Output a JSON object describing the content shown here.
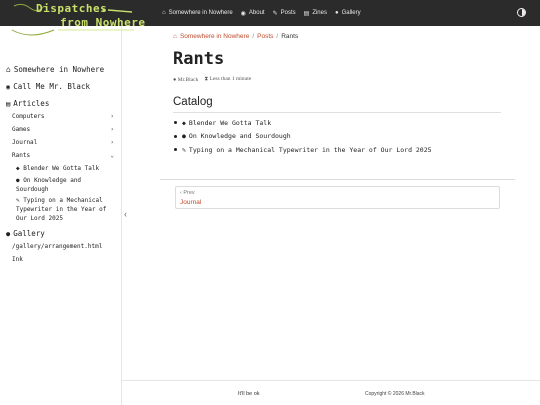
{
  "site": {
    "logo_line1": "Dispatches",
    "logo_line2": "from Nowhere"
  },
  "nav": {
    "items": [
      {
        "label": "Somewhere in Nowhere",
        "icon": "home-icon"
      },
      {
        "label": "About",
        "icon": "eye-icon"
      },
      {
        "label": "Posts",
        "icon": "edit-icon"
      },
      {
        "label": "Zines",
        "icon": "book-icon"
      },
      {
        "label": "Gallery",
        "icon": "palette-icon"
      }
    ],
    "theme_icon": "contrast-icon"
  },
  "sidebar": {
    "home": "Somewhere in Nowhere",
    "call": "Call Me Mr. Black",
    "articles": "Articles",
    "categories": [
      {
        "label": "Computers",
        "chevron": "›"
      },
      {
        "label": "Games",
        "chevron": "›"
      },
      {
        "label": "Journal",
        "chevron": "›"
      },
      {
        "label": "Rants",
        "chevron": "⌄"
      }
    ],
    "rants": [
      {
        "label": "Blender We Gotta Talk",
        "icon": "cube-icon"
      },
      {
        "label": "On Knowledge and Sourdough",
        "icon": "person-icon"
      },
      {
        "label": "Typing on a Mechanical Typewriter in the Year of Our Lord 2025",
        "icon": "pencil-icon"
      }
    ],
    "gallery": "Gallery",
    "gallery_links": [
      "/gallery/arrangement.html",
      "Ink"
    ],
    "collapse": "‹"
  },
  "breadcrumb": {
    "home": "Somewhere in Nowhere",
    "posts": "Posts",
    "current": "Rants",
    "sep": "/"
  },
  "page": {
    "title": "Rants",
    "author": "Mr.Black",
    "reading_time": "Less than 1 minute"
  },
  "catalog": {
    "title": "Catalog",
    "items": [
      {
        "label": "Blender We Gotta Talk",
        "icon": "cube-icon"
      },
      {
        "label": "On Knowledge and Sourdough",
        "icon": "person-icon"
      },
      {
        "label": "Typing on a Mechanical Typewriter in the Year of Our Lord 2025",
        "icon": "pencil-icon"
      }
    ]
  },
  "pager": {
    "prev_label": "‹ Prev",
    "prev_title": "Journal"
  },
  "footer": {
    "left": "It'll be ok",
    "right": "Copyright © 2026 Mr.Black"
  },
  "colors": {
    "accent": "#c0492b",
    "navbar": "#2b2b2b",
    "logo": "#c9e06a"
  }
}
